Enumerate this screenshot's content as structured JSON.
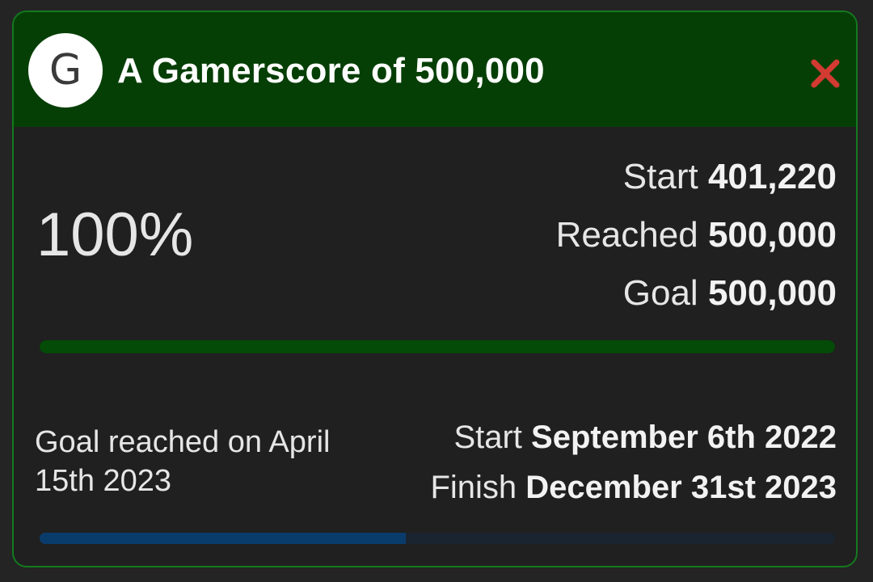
{
  "goal": {
    "avatar_letter": "G",
    "title": "A Gamerscore of 500,000",
    "percent_text": "100%",
    "progress_fraction": 1.0,
    "stats": {
      "start_label": "Start",
      "start_value": "401,220",
      "reached_label": "Reached",
      "reached_value": "500,000",
      "goal_label": "Goal",
      "goal_value": "500,000"
    },
    "reached_note": "Goal reached on April 15th 2023",
    "dates": {
      "start_label": "Start",
      "start_value": "September 6th 2022",
      "finish_label": "Finish",
      "finish_value": "December 31st 2023"
    },
    "time_fraction": 0.46
  },
  "colors": {
    "header_bg": "#063f06",
    "border": "#137a1e",
    "progress_fill": "#044b07",
    "time_fill": "#0a3c6b",
    "close_icon": "#d23a32"
  },
  "icons": {
    "close": "close-icon"
  }
}
